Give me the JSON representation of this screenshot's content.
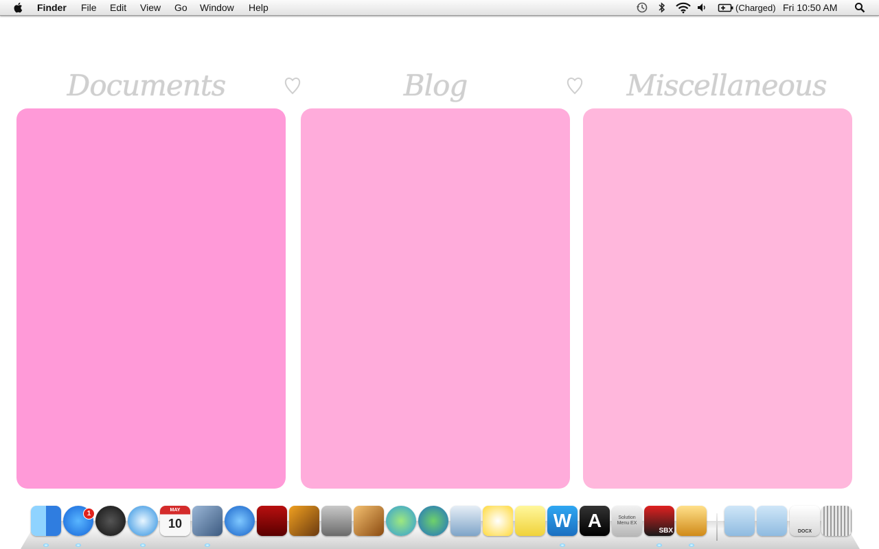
{
  "menubar": {
    "apple_icon": "apple-icon",
    "app_name": "Finder",
    "menus": [
      "File",
      "Edit",
      "View",
      "Go",
      "Window",
      "Help"
    ],
    "status": {
      "icons": [
        "time-machine-icon",
        "bluetooth-icon",
        "wifi-icon",
        "volume-icon",
        "battery-icon",
        "spotlight-icon"
      ],
      "battery_text": "(Charged)",
      "clock": "Fri 10:50 AM"
    }
  },
  "desktop": {
    "panels": [
      {
        "title": "Documents",
        "color": "#ff9ad8"
      },
      {
        "title": "Blog",
        "color": "#ffacdb"
      },
      {
        "title": "Miscellaneous",
        "color": "#ffb7dc"
      }
    ],
    "heart_color": "#cfcfcf"
  },
  "dock": {
    "apps": [
      {
        "name": "finder-icon",
        "running": true
      },
      {
        "name": "app-store-icon",
        "running": true,
        "badge": "1"
      },
      {
        "name": "dashboard-icon",
        "running": false
      },
      {
        "name": "safari-icon",
        "running": true
      },
      {
        "name": "ical-icon",
        "running": false,
        "label_month": "MAY",
        "label_day": "10"
      },
      {
        "name": "iphoto-icon",
        "running": true
      },
      {
        "name": "itunes-icon",
        "running": false
      },
      {
        "name": "front-row-icon",
        "running": false
      },
      {
        "name": "photo-booth-icon",
        "running": false
      },
      {
        "name": "system-preferences-icon",
        "running": false
      },
      {
        "name": "garageband-icon",
        "running": false
      },
      {
        "name": "messenger-icon",
        "running": false
      },
      {
        "name": "network-globe-icon",
        "running": false
      },
      {
        "name": "remote-desktop-icon",
        "running": false
      },
      {
        "name": "color-palette-icon",
        "running": false
      },
      {
        "name": "stickies-icon",
        "running": false
      },
      {
        "name": "word-icon",
        "running": true,
        "label": "W"
      },
      {
        "name": "font-app-icon",
        "running": false,
        "label": "A"
      },
      {
        "name": "solution-menu-icon",
        "running": false,
        "label": "Solution Menu EX"
      },
      {
        "name": "sbx-icon",
        "running": true,
        "label": "SBX"
      },
      {
        "name": "paint-bucket-icon",
        "running": true
      }
    ],
    "stacks": [
      {
        "name": "applications-folder-icon"
      },
      {
        "name": "documents-folder-icon"
      },
      {
        "name": "docx-file-icon",
        "label": "DOCX"
      },
      {
        "name": "trash-icon"
      }
    ]
  }
}
